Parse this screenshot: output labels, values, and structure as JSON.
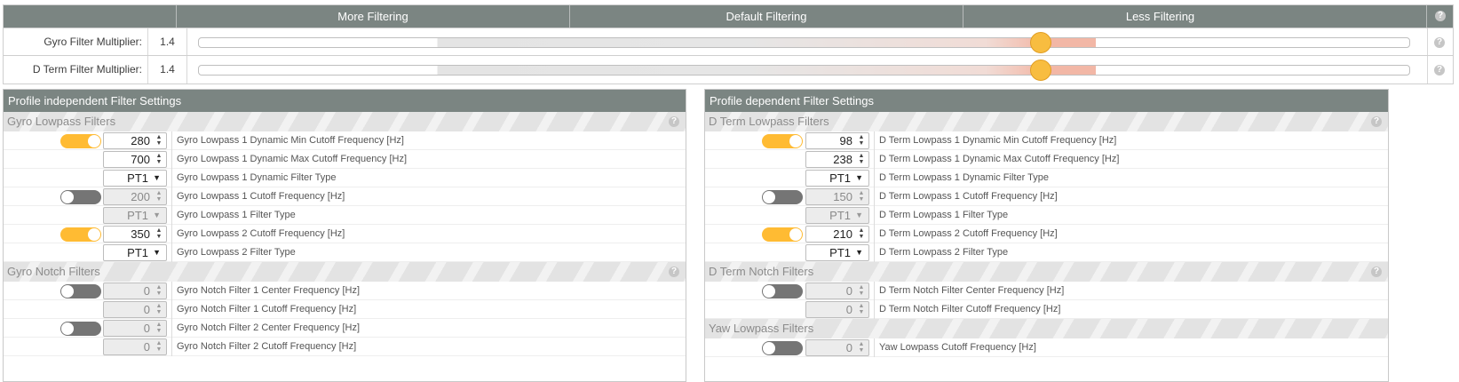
{
  "slider_table": {
    "headers": [
      "More Filtering",
      "Default Filtering",
      "Less Filtering"
    ],
    "help": "?",
    "rows": [
      {
        "label": "Gyro Filter Multiplier:",
        "value": "1.4",
        "level": 0.695
      },
      {
        "label": "D Term Filter Multiplier:",
        "value": "1.4",
        "level": 0.695
      }
    ]
  },
  "left_panel": {
    "title": "Profile independent Filter Settings",
    "sections": [
      {
        "title": "Gyro Lowpass Filters",
        "help": "?",
        "rows": [
          {
            "toggle": "on",
            "value": "280",
            "kind": "number",
            "disabled": false,
            "label": "Gyro Lowpass 1 Dynamic Min Cutoff Frequency [Hz]"
          },
          {
            "toggle": "",
            "value": "700",
            "kind": "number",
            "disabled": false,
            "label": "Gyro Lowpass 1 Dynamic Max Cutoff Frequency [Hz]"
          },
          {
            "toggle": "",
            "value": "PT1",
            "kind": "select",
            "disabled": false,
            "label": "Gyro Lowpass 1 Dynamic Filter Type"
          },
          {
            "toggle": "off",
            "value": "200",
            "kind": "number",
            "disabled": true,
            "label": "Gyro Lowpass 1 Cutoff Frequency [Hz]"
          },
          {
            "toggle": "",
            "value": "PT1",
            "kind": "select",
            "disabled": true,
            "label": "Gyro Lowpass 1 Filter Type"
          },
          {
            "toggle": "on",
            "value": "350",
            "kind": "number",
            "disabled": false,
            "label": "Gyro Lowpass 2 Cutoff Frequency [Hz]"
          },
          {
            "toggle": "",
            "value": "PT1",
            "kind": "select",
            "disabled": false,
            "label": "Gyro Lowpass 2 Filter Type"
          }
        ]
      },
      {
        "title": "Gyro Notch Filters",
        "help": "?",
        "rows": [
          {
            "toggle": "off",
            "value": "0",
            "kind": "number",
            "disabled": true,
            "label": "Gyro Notch Filter 1 Center Frequency [Hz]"
          },
          {
            "toggle": "",
            "value": "0",
            "kind": "number",
            "disabled": true,
            "label": "Gyro Notch Filter 1 Cutoff Frequency [Hz]"
          },
          {
            "toggle": "off",
            "value": "0",
            "kind": "number",
            "disabled": true,
            "label": "Gyro Notch Filter 2 Center Frequency [Hz]"
          },
          {
            "toggle": "",
            "value": "0",
            "kind": "number",
            "disabled": true,
            "label": "Gyro Notch Filter 2 Cutoff Frequency [Hz]"
          }
        ]
      }
    ]
  },
  "right_panel": {
    "title": "Profile dependent Filter Settings",
    "sections": [
      {
        "title": "D Term Lowpass Filters",
        "help": "?",
        "rows": [
          {
            "toggle": "on",
            "value": "98",
            "kind": "number",
            "disabled": false,
            "label": "D Term Lowpass 1 Dynamic Min Cutoff Frequency [Hz]"
          },
          {
            "toggle": "",
            "value": "238",
            "kind": "number",
            "disabled": false,
            "label": "D Term Lowpass 1 Dynamic Max Cutoff Frequency [Hz]"
          },
          {
            "toggle": "",
            "value": "PT1",
            "kind": "select",
            "disabled": false,
            "label": "D Term Lowpass 1 Dynamic Filter Type"
          },
          {
            "toggle": "off",
            "value": "150",
            "kind": "number",
            "disabled": true,
            "label": "D Term Lowpass 1 Cutoff Frequency [Hz]"
          },
          {
            "toggle": "",
            "value": "PT1",
            "kind": "select",
            "disabled": true,
            "label": "D Term Lowpass 1 Filter Type"
          },
          {
            "toggle": "on",
            "value": "210",
            "kind": "number",
            "disabled": false,
            "label": "D Term Lowpass 2 Cutoff Frequency [Hz]"
          },
          {
            "toggle": "",
            "value": "PT1",
            "kind": "select",
            "disabled": false,
            "label": "D Term Lowpass 2 Filter Type"
          }
        ]
      },
      {
        "title": "D Term Notch Filters",
        "help": "?",
        "rows": [
          {
            "toggle": "off",
            "value": "0",
            "kind": "number",
            "disabled": true,
            "label": "D Term Notch Filter Center Frequency [Hz]"
          },
          {
            "toggle": "",
            "value": "0",
            "kind": "number",
            "disabled": true,
            "label": "D Term Notch Filter Cutoff Frequency [Hz]"
          }
        ]
      },
      {
        "title": "Yaw Lowpass Filters",
        "help": "",
        "rows": [
          {
            "toggle": "off",
            "value": "0",
            "kind": "number",
            "disabled": true,
            "label": "Yaw Lowpass Cutoff Frequency [Hz]"
          }
        ]
      }
    ]
  },
  "colors": {
    "header_bg": "#7b8582",
    "toggle_on": "#ffbb33",
    "toggle_off": "#757575",
    "thumb": "#f8bd40",
    "slider_fill": "#f2b7a6"
  }
}
